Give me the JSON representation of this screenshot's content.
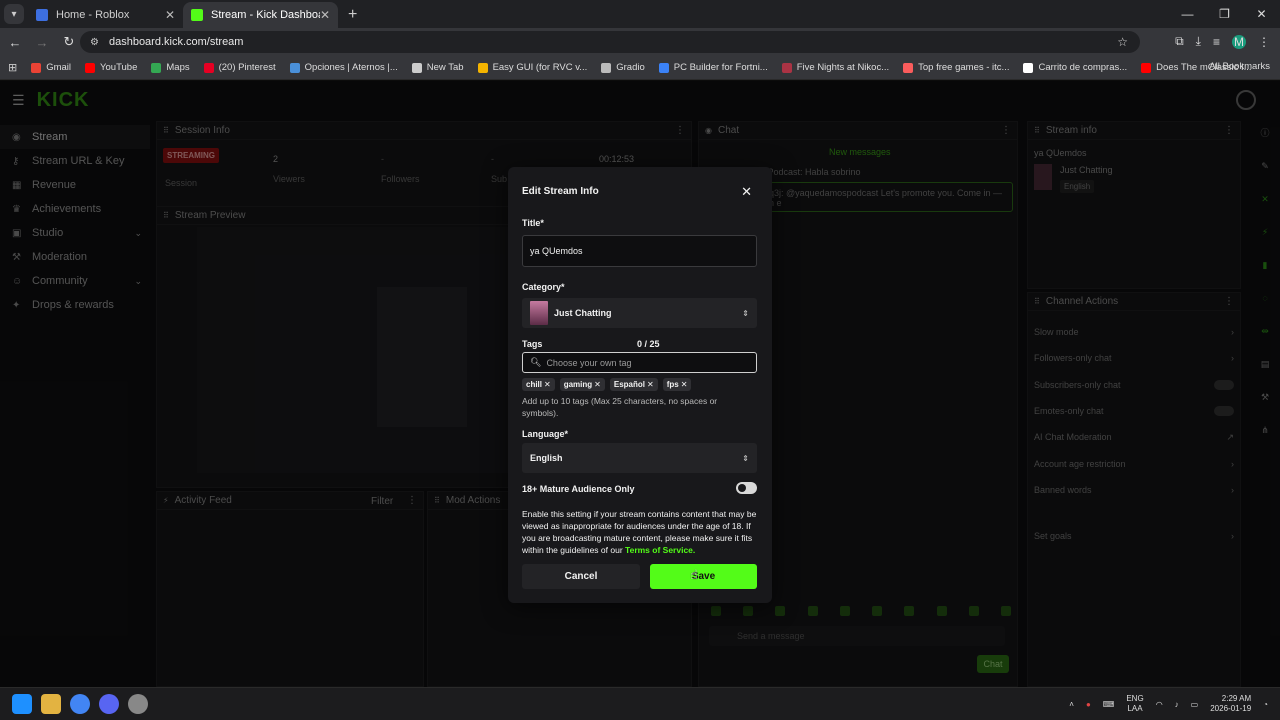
{
  "browser": {
    "tabs": [
      {
        "title": "Home - Roblox",
        "active": false,
        "color": "#3d6fe0"
      },
      {
        "title": "Stream - Kick Dashboard",
        "active": true,
        "color": "#53fc18"
      }
    ],
    "url": "dashboard.kick.com/stream",
    "profile_initial": "M",
    "bookmarks": [
      {
        "label": "Gmail",
        "color": "#ea4335"
      },
      {
        "label": "YouTube",
        "color": "#ff0000"
      },
      {
        "label": "Maps",
        "color": "#34a853"
      },
      {
        "label": "(20) Pinterest",
        "color": "#e60023"
      },
      {
        "label": "Opciones | Aternos |...",
        "color": "#4a90d9"
      },
      {
        "label": "New Tab",
        "color": "#cccccc"
      },
      {
        "label": "Easy GUI (for RVC v...",
        "color": "#f4b400"
      },
      {
        "label": "Gradio",
        "color": "#bbbbbb"
      },
      {
        "label": "PC Builder for Fortni...",
        "color": "#3b82f6"
      },
      {
        "label": "Five Nights at Nikoc...",
        "color": "#aa3344"
      },
      {
        "label": "Top free games - itc...",
        "color": "#fa5c5c"
      },
      {
        "label": "Carrito de compras...",
        "color": "#ffffff"
      },
      {
        "label": "Does The mClassic I...",
        "color": "#ff0000"
      }
    ],
    "all_bookmarks": "All Bookmarks"
  },
  "sidebar": {
    "items": [
      {
        "label": "Stream",
        "icon": "broadcast-icon",
        "active": true
      },
      {
        "label": "Stream URL & Key",
        "icon": "key-icon"
      },
      {
        "label": "Revenue",
        "icon": "revenue-icon"
      },
      {
        "label": "Achievements",
        "icon": "trophy-icon"
      },
      {
        "label": "Studio",
        "icon": "studio-icon",
        "chevron": true
      },
      {
        "label": "Moderation",
        "icon": "hammer-icon"
      },
      {
        "label": "Community",
        "icon": "community-icon",
        "chevron": true
      },
      {
        "label": "Drops & rewards",
        "icon": "gift-icon"
      }
    ]
  },
  "session_info": {
    "title": "Session Info",
    "badge": "STREAMING",
    "session_label": "Session",
    "viewers_value": "2",
    "viewers_label": "Viewers",
    "followers_value": "-",
    "followers_label": "Followers",
    "subs_value": "-",
    "subs_label": "Sub",
    "timer": "00:12:53"
  },
  "stream_preview": {
    "title": "Stream Preview"
  },
  "activity_feed": {
    "title": "Activity Feed",
    "filter": "Filter"
  },
  "mod_actions": {
    "title": "Mod Actions"
  },
  "chat": {
    "title": "Chat",
    "new_messages": "New messages",
    "message": "sPodcast: Habla sobrino",
    "promo": "q3j: @yaquedamospodcast Let's promote you. Come in — n e",
    "input_placeholder": "Send a message",
    "send_label": "Chat"
  },
  "stream_info_panel": {
    "title": "Stream info",
    "stream_title": "ya QUemdos",
    "category": "Just Chatting",
    "language": "English"
  },
  "channel_actions": {
    "title": "Channel Actions",
    "items": [
      {
        "label": "Slow mode",
        "kind": "chevron"
      },
      {
        "label": "Followers-only chat",
        "kind": "chevron"
      },
      {
        "label": "Subscribers-only chat",
        "kind": "toggle"
      },
      {
        "label": "Emotes-only chat",
        "kind": "toggle"
      },
      {
        "label": "AI Chat Moderation",
        "kind": "link"
      },
      {
        "label": "Account age restriction",
        "kind": "chevron"
      },
      {
        "label": "Banned words",
        "kind": "chevron"
      },
      {
        "label": "Set goals",
        "kind": "chevron"
      }
    ]
  },
  "modal": {
    "title": "Edit Stream Info",
    "title_label": "Title*",
    "title_value": "ya QUemdos",
    "category_label": "Category*",
    "category_value": "Just Chatting",
    "tags_label": "Tags",
    "tags_counter": "0 / 25",
    "tags_placeholder": "Choose your own tag",
    "tags": [
      "chill",
      "gaming",
      "Español",
      "fps"
    ],
    "tags_help": "Add up to 10 tags (Max 25 characters, no spaces or symbols).",
    "language_label": "Language*",
    "language_value": "English",
    "mature_label": "18+ Mature Audience Only",
    "mature_enabled": false,
    "warning_text": "Enable this setting if your stream contains content that may be viewed as inappropriate for audiences under the age of 18. If you are broadcasting mature content, please make sure it fits within the guidelines of our",
    "tos_link": "Terms of Service.",
    "cancel_label": "Cancel",
    "save_label": "Save"
  },
  "taskbar": {
    "lang_top": "ENG",
    "lang_bottom": "LAA",
    "time": "2:29 AM",
    "date": "2026-01-19"
  },
  "colors": {
    "accent": "#53fc18",
    "background": "#0e0e10",
    "modal": "#18181b"
  }
}
